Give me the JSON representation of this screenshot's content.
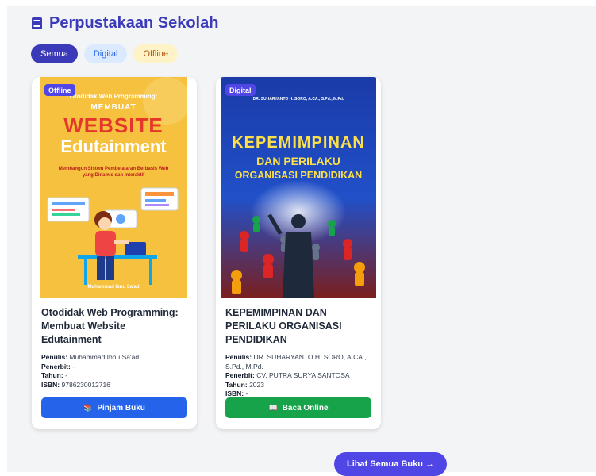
{
  "page": {
    "title": "Perpustakaan Sekolah",
    "title_icon": "book-icon"
  },
  "filters": [
    {
      "label": "Semua",
      "active": true
    },
    {
      "label": "Digital",
      "active": false
    },
    {
      "label": "Offline",
      "active": false
    }
  ],
  "books": [
    {
      "badge": "Offline",
      "cover": {
        "line1": "Otodidak Web Programming:",
        "line2": "MEMBUAT",
        "line3": "WEBSITE",
        "line4": "Edutainment",
        "subtitle": "Membangun Sistem Pembelajaran Berbasis Web yang Dinamis dan Interaktif",
        "author": "Muhammad Ibnu Sa'ad",
        "colors": {
          "bg": "#f6c13e",
          "title": "#e4362b",
          "accent": "#ffffff"
        }
      },
      "title": "Otodidak Web Programming: Membuat Website Edutainment",
      "penulis_label": "Penulis:",
      "penulis": "Muhammad Ibnu Sa'ad",
      "penerbit_label": "Penerbit:",
      "penerbit": "-",
      "tahun_label": "Tahun:",
      "tahun": "-",
      "isbn_label": "ISBN:",
      "isbn": "9786230012716",
      "button": {
        "label": "Pinjam Buku",
        "icon": "books-icon",
        "color": "#2563eb"
      }
    },
    {
      "badge": "Digital",
      "cover": {
        "author_line": "DR. SUHARYANTO H. SORO, A.CA., S.Pd., M.Pd.",
        "line1": "KEPEMIMPINAN",
        "line2": "DAN PERILAKU",
        "line3": "ORGANISASI PENDIDIKAN",
        "colors": {
          "bg": "#1c3fa8",
          "title": "#fde047"
        }
      },
      "title": "KEPEMIMPINAN DAN PERILAKU ORGANISASI PENDIDIKAN",
      "penulis_label": "Penulis:",
      "penulis": "DR. SUHARYANTO H. SORO, A.CA., S.Pd., M.Pd.",
      "penerbit_label": "Penerbit:",
      "penerbit": "CV. PUTRA SURYA SANTOSA",
      "tahun_label": "Tahun:",
      "tahun": "2023",
      "isbn_label": "ISBN:",
      "isbn": "-",
      "button": {
        "label": "Baca Online",
        "icon": "open-book-icon",
        "color": "#16a34a"
      }
    }
  ],
  "see_all": {
    "label": "Lihat Semua Buku →"
  },
  "colors": {
    "primary": "#3b3ab8",
    "background": "#f3f4f6"
  }
}
